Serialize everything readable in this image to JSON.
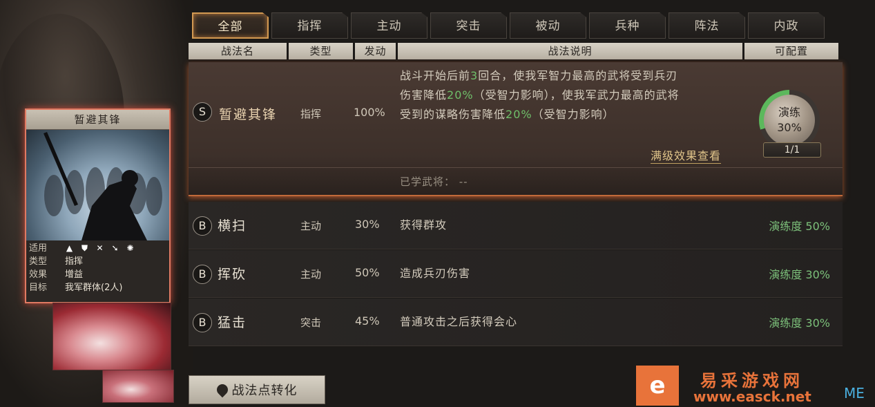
{
  "tabs": [
    "全部",
    "指挥",
    "主动",
    "突击",
    "被动",
    "兵种",
    "阵法",
    "内政"
  ],
  "headers": {
    "name": "战法名",
    "type": "类型",
    "rate": "发动",
    "desc": "战法说明",
    "config": "可配置"
  },
  "card": {
    "title": "暂避其锋",
    "info": [
      {
        "key": "适用",
        "value": ""
      },
      {
        "key": "类型",
        "value": "指挥"
      },
      {
        "key": "效果",
        "value": "增益"
      },
      {
        "key": "目标",
        "value": "我军群体(2人)"
      }
    ]
  },
  "selected_skill": {
    "grade": "S",
    "name": "暂避其锋",
    "type": "指挥",
    "rate": "100%",
    "desc_line1_a": "战斗开始后前",
    "desc_line1_num": "3",
    "desc_line1_b": "回合，使我军智力最高的武将受到兵刃",
    "desc_line2_a": "伤害降低",
    "desc_line2_num": "20%",
    "desc_line2_b": "（受智力影响），使我军武力最高的武将",
    "desc_line3_a": "受到的谋略伤害降低",
    "desc_line3_num": "20%",
    "desc_line3_b": "（受智力影响）",
    "more_link": "满级效果查看",
    "learned": "已学武将：  --",
    "drill_label": "演练",
    "drill_percent": "30%",
    "drill_progress": 0.3,
    "drill_count": "1/1"
  },
  "skills": [
    {
      "grade": "B",
      "name": "横扫",
      "type": "主动",
      "rate": "30%",
      "desc": "获得群攻",
      "proficiency": "演练度 50%"
    },
    {
      "grade": "B",
      "name": "挥砍",
      "type": "主动",
      "rate": "50%",
      "desc": "造成兵刃伤害",
      "proficiency": "演练度 30%"
    },
    {
      "grade": "B",
      "name": "猛击",
      "type": "突击",
      "rate": "45%",
      "desc": "普通攻击之后获得会心",
      "proficiency": "演练度 30%"
    }
  ],
  "convert_button": "战法点转化",
  "watermark": {
    "logo": "e",
    "line1": "易采游戏网",
    "line2": "www.easck.net",
    "suffix": "ME"
  }
}
